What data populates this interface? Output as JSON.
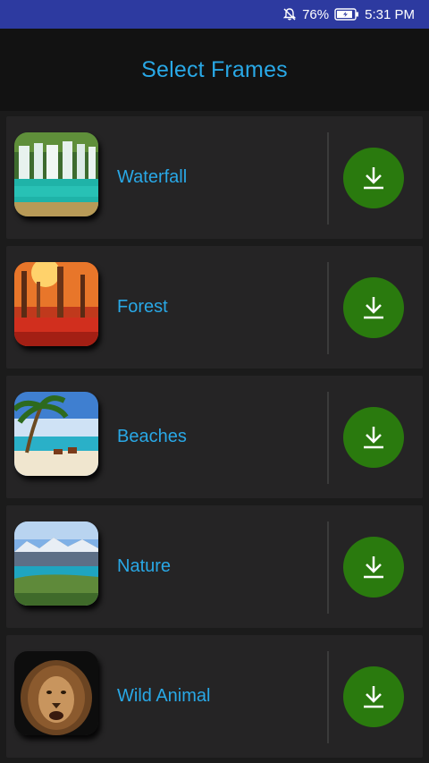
{
  "status_bar": {
    "battery": "76%",
    "time": "5:31 PM",
    "icons": [
      "notifications-off-icon",
      "battery-charging-icon"
    ]
  },
  "app_bar": {
    "title": "Select Frames"
  },
  "frames": [
    {
      "label": "Waterfall",
      "thumb": "waterfall-thumbnail"
    },
    {
      "label": "Forest",
      "thumb": "forest-thumbnail"
    },
    {
      "label": "Beaches",
      "thumb": "beach-thumbnail"
    },
    {
      "label": "Nature",
      "thumb": "nature-thumbnail"
    },
    {
      "label": "Wild Animal",
      "thumb": "lion-thumbnail"
    }
  ],
  "colors": {
    "status_bar": "#2d3aa0",
    "accent_text": "#29a8e6",
    "download_button": "#2a7a0e",
    "card": "#252425"
  }
}
